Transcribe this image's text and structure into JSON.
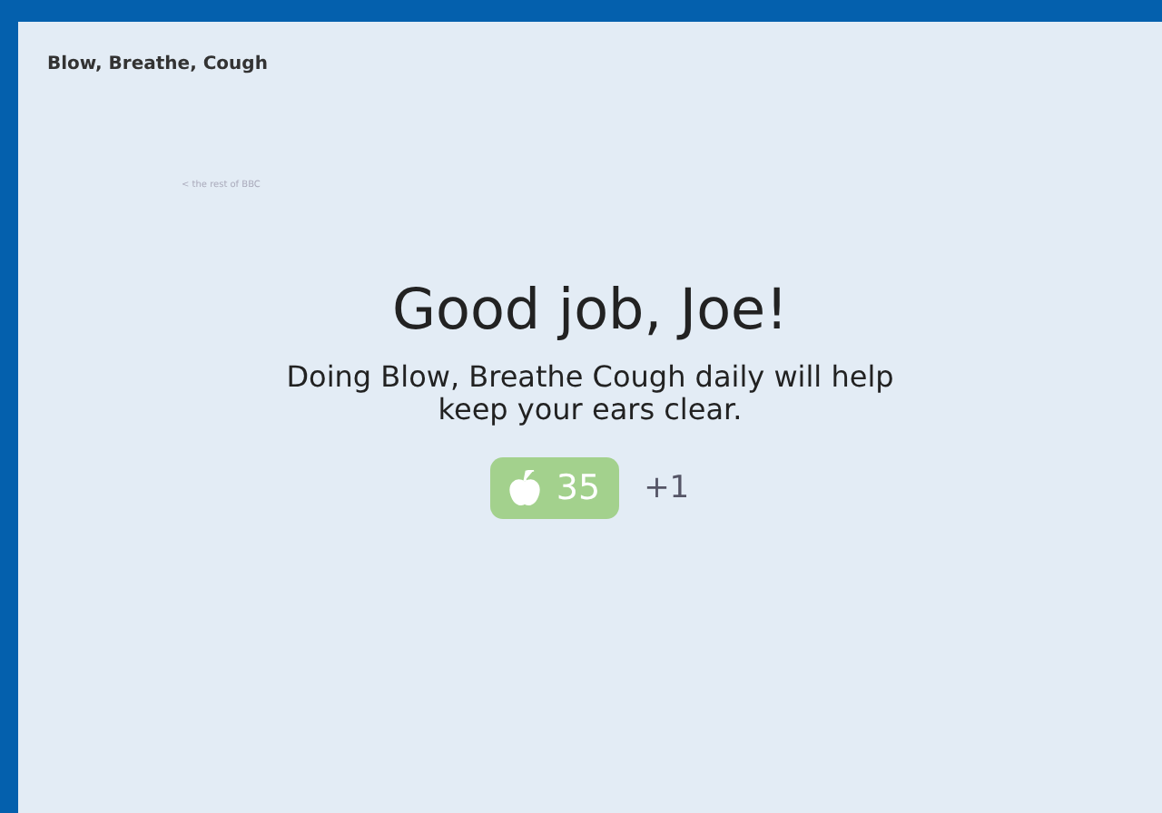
{
  "header": {
    "title": "Blow, Breathe, Cough"
  },
  "back_link": "< the rest of BBC",
  "heading": "Good job, Joe!",
  "message": "Doing Blow, Breathe Cough daily will help keep your ears clear.",
  "score": {
    "count": "35",
    "increment": "+1"
  }
}
